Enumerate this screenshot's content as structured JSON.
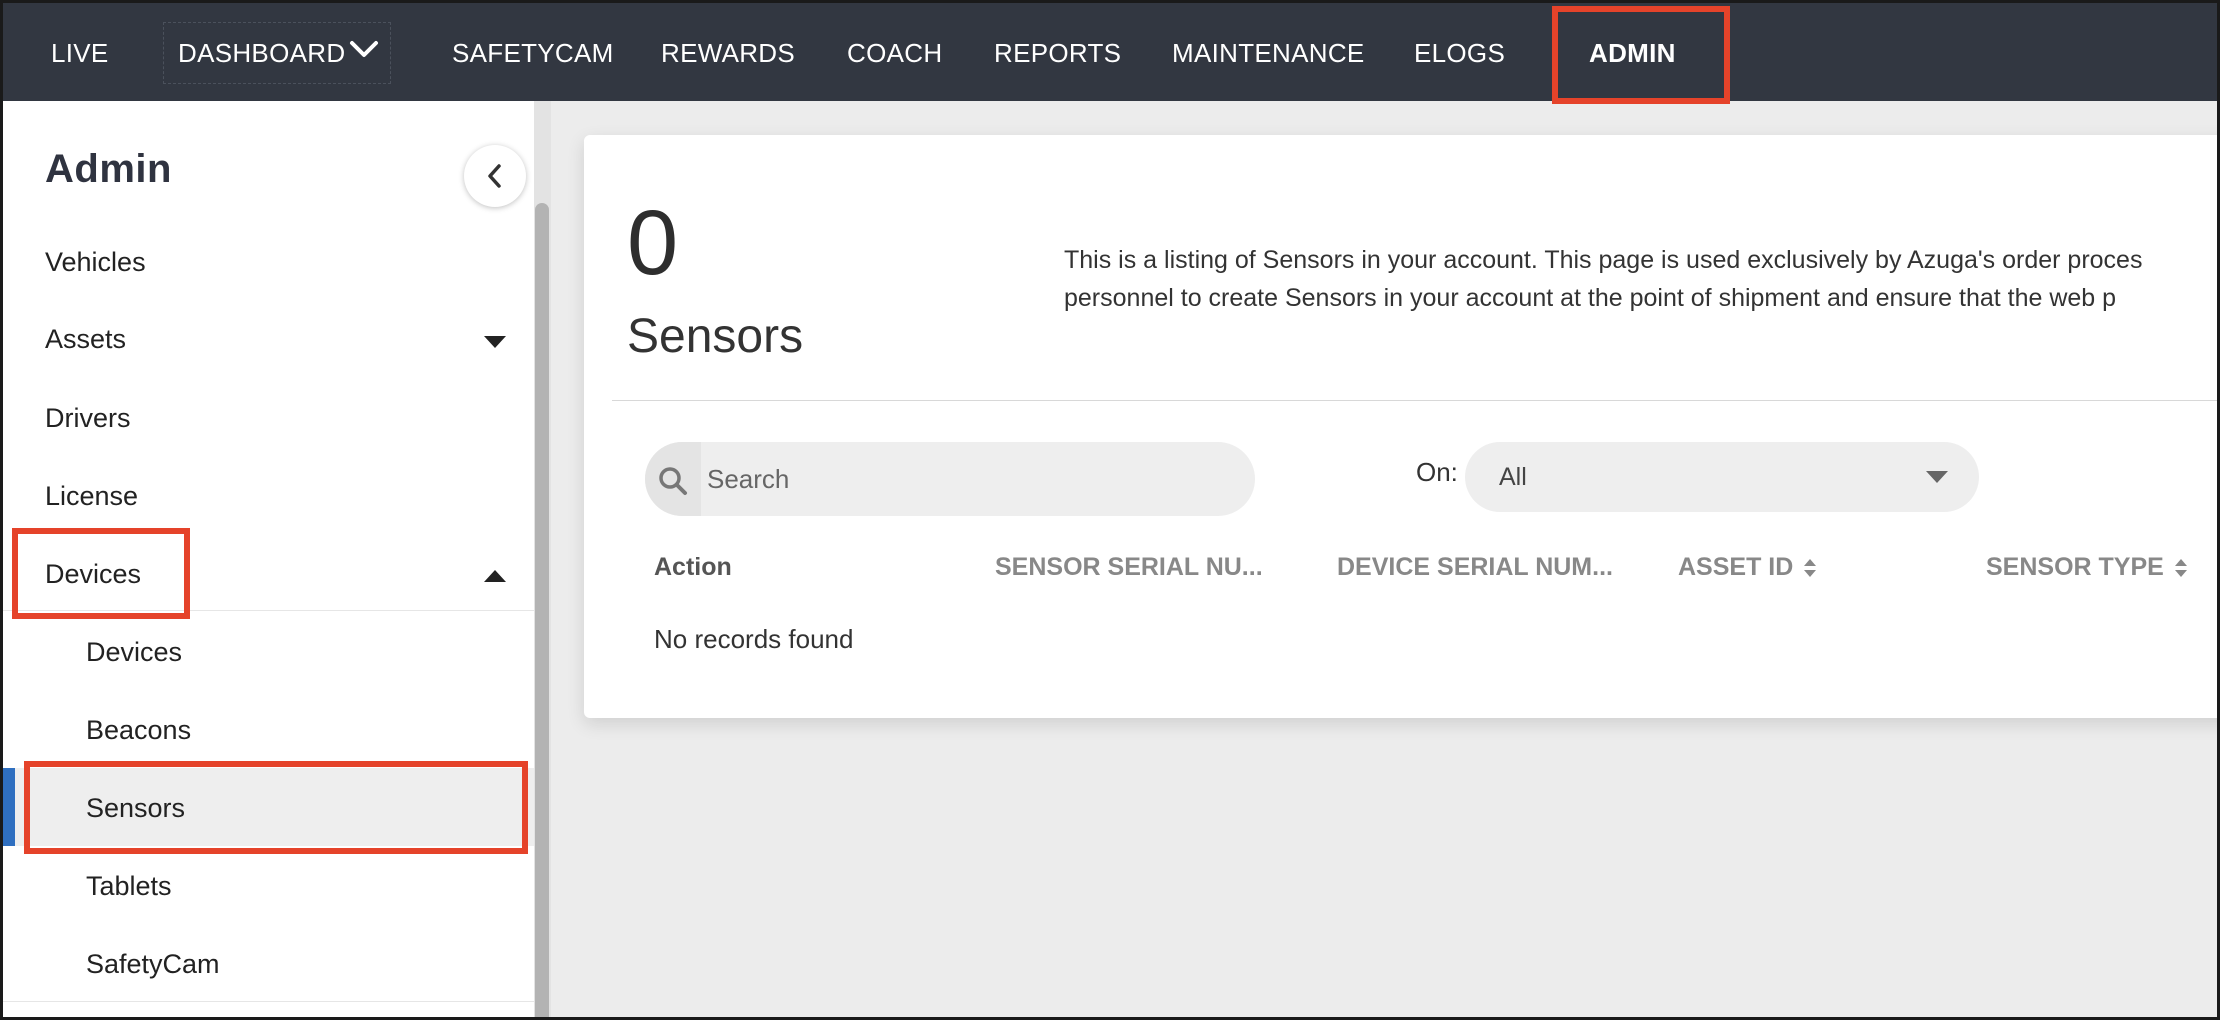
{
  "nav": {
    "items": [
      "LIVE",
      "DASHBOARD",
      "SAFETYCAM",
      "REWARDS",
      "COACH",
      "REPORTS",
      "MAINTENANCE",
      "ELOGS",
      "ADMIN"
    ],
    "active": "ADMIN"
  },
  "sidebar": {
    "title": "Admin",
    "items": {
      "vehicles": "Vehicles",
      "assets": "Assets",
      "drivers": "Drivers",
      "license": "License",
      "devices": "Devices"
    },
    "sub_items": {
      "devices": "Devices",
      "beacons": "Beacons",
      "sensors": "Sensors",
      "tablets": "Tablets",
      "safetycam": "SafetyCam"
    },
    "selected": "Sensors"
  },
  "main": {
    "count": "0",
    "title": "Sensors",
    "description_line1": "This is a listing of Sensors in your account. This page is used exclusively by Azuga's order proces",
    "description_line2": "personnel to create Sensors in your account at the point of shipment and ensure that the web p",
    "search_placeholder": "Search",
    "filter_label": "On:",
    "filter_value": "All",
    "columns": [
      "Action",
      "SENSOR SERIAL NU...",
      "DEVICE SERIAL NUM...",
      "ASSET ID",
      "SENSOR TYPE"
    ],
    "empty_message": "No records found"
  },
  "colors": {
    "nav_bg": "#323741",
    "highlight": "#e5432a",
    "selected_bar": "#2f6fc0"
  }
}
